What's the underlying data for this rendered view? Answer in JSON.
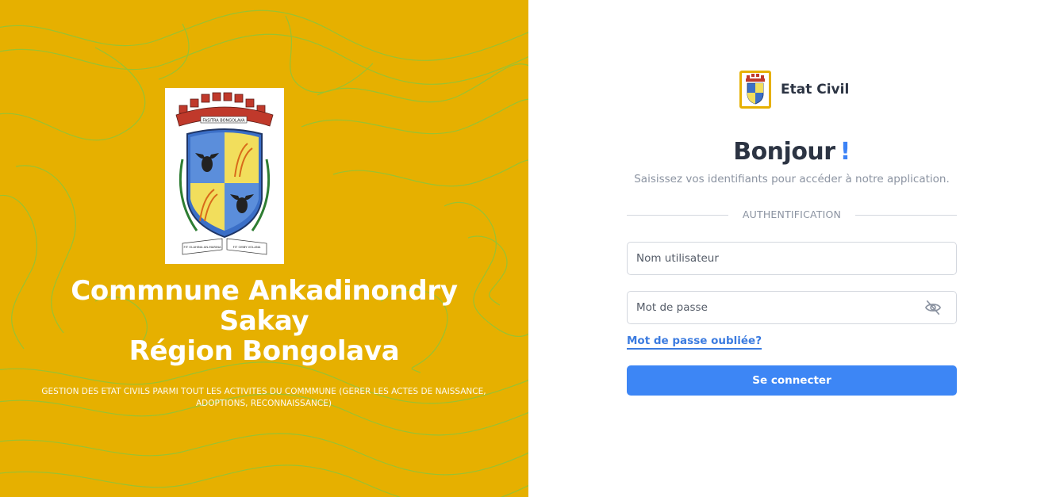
{
  "left_panel": {
    "title_lines": [
      "Commnune Ankadinondry",
      "Sakay",
      "Région Bongolava"
    ],
    "description": "GESTION DES ETAT CIVILS PARMI TOUT LES ACTIVITES DU COMMMUNE (GERER LES ACTES DE NAISSANCE, ADOPTIONS, RECONNAISSANCE)",
    "crest": {
      "banner_top": "FASITRA BONGOLAVA",
      "ribbon_left": "FIT OLAHINA AN-MARINA",
      "ribbon_right": "FIT OMBY VOLANA"
    },
    "background_color": "#e6b000",
    "contour_color": "#6bc63f"
  },
  "brand": {
    "name": "Etat Civil",
    "logo_icon": "crest-logo-icon"
  },
  "login": {
    "greeting": "Bonjour",
    "greeting_mark": "!",
    "subtitle": "Saisissez vos identifiants pour accéder à notre application.",
    "divider_label": "AUTHENTIFICATION",
    "username_placeholder": "Nom utilisateur",
    "password_placeholder": "Mot de passe",
    "password_toggle_icon": "eye-off-icon",
    "forgot_password": "Mot de passe oubliée?",
    "submit_label": "Se connecter",
    "accent_color": "#3d86f5"
  }
}
